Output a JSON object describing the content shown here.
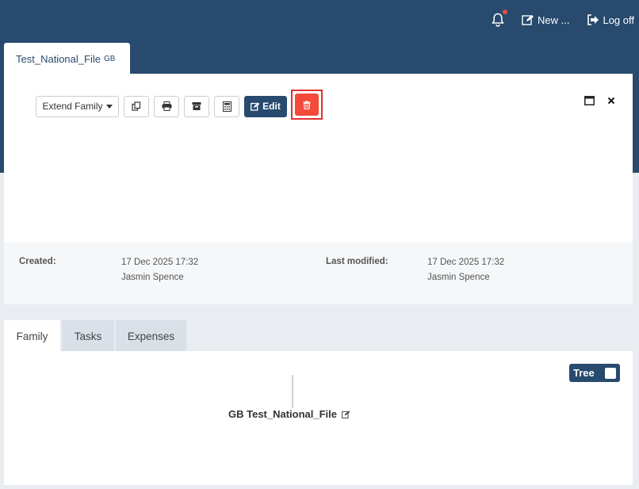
{
  "header": {
    "new_label": "New ...",
    "logoff_label": "Log off"
  },
  "file_tab": {
    "title": "Test_National_File",
    "suffix": "GB"
  },
  "toolbar": {
    "extend_label": "Extend Family",
    "edit_label": "Edit"
  },
  "meta": {
    "created_label": "Created:",
    "created_date": "17 Dec 2025 17:32",
    "created_by": "Jasmin Spence",
    "modified_label": "Last modified:",
    "modified_date": "17 Dec 2025 17:32",
    "modified_by": "Jasmin Spence"
  },
  "tabs": [
    "Family",
    "Tasks",
    "Expenses"
  ],
  "family": {
    "tree_label": "Tree",
    "node_label": "GB Test_National_File"
  },
  "colors": {
    "primary": "#274a6e",
    "danger": "#f44a3a",
    "notification": "#e74c3c"
  }
}
